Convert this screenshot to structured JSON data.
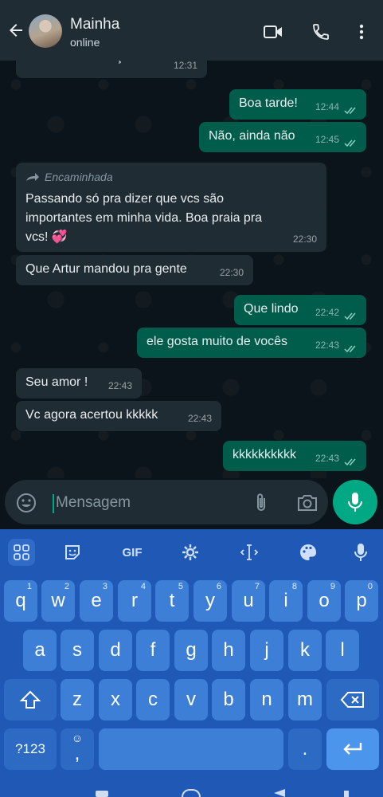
{
  "header": {
    "name": "Mainha",
    "status": "online"
  },
  "messages": [
    {
      "text": "Boa tarde! Almoçou?",
      "time": "12:31",
      "dir": "in"
    },
    {
      "text": "Boa tarde!",
      "time": "12:44",
      "dir": "out"
    },
    {
      "text": "Não, ainda não",
      "time": "12:45",
      "dir": "out"
    },
    {
      "forward_label": "Encaminhada",
      "text": "Passando só pra dizer que vcs são importantes em minha vida. Boa praia pra vcs! 💞",
      "time": "22:30",
      "dir": "in"
    },
    {
      "text": "Que Artur mandou pra gente",
      "time": "22:30",
      "dir": "in"
    },
    {
      "text": "Que lindo",
      "time": "22:42",
      "dir": "out"
    },
    {
      "text": "ele gosta muito de vocês",
      "time": "22:43",
      "dir": "out"
    },
    {
      "text": "Seu amor !",
      "time": "22:43",
      "dir": "in"
    },
    {
      "text": "Vc agora acertou kkkkk",
      "time": "22:43",
      "dir": "in"
    },
    {
      "text": "kkkkkkkkkk",
      "time": "22:43",
      "dir": "out"
    }
  ],
  "composer": {
    "placeholder": "Mensagem"
  },
  "keyboard": {
    "toolbar": {
      "gif": "GIF"
    },
    "row1": [
      {
        "key": "q",
        "hint": "1"
      },
      {
        "key": "w",
        "hint": "2"
      },
      {
        "key": "e",
        "hint": "3"
      },
      {
        "key": "r",
        "hint": "4"
      },
      {
        "key": "t",
        "hint": "5"
      },
      {
        "key": "y",
        "hint": "6"
      },
      {
        "key": "u",
        "hint": "7"
      },
      {
        "key": "i",
        "hint": "8"
      },
      {
        "key": "o",
        "hint": "9"
      },
      {
        "key": "p",
        "hint": "0"
      }
    ],
    "row2": [
      "a",
      "s",
      "d",
      "f",
      "g",
      "h",
      "j",
      "k",
      "l"
    ],
    "row3": [
      "z",
      "x",
      "c",
      "v",
      "b",
      "n",
      "m"
    ],
    "symbols": "?123",
    "comma": ",",
    "period": "."
  },
  "colors": {
    "header": "#1f2c34",
    "incoming": "#202c33",
    "outgoing": "#005c4b",
    "accent": "#00a884",
    "keyboard": "#1f58b5"
  }
}
